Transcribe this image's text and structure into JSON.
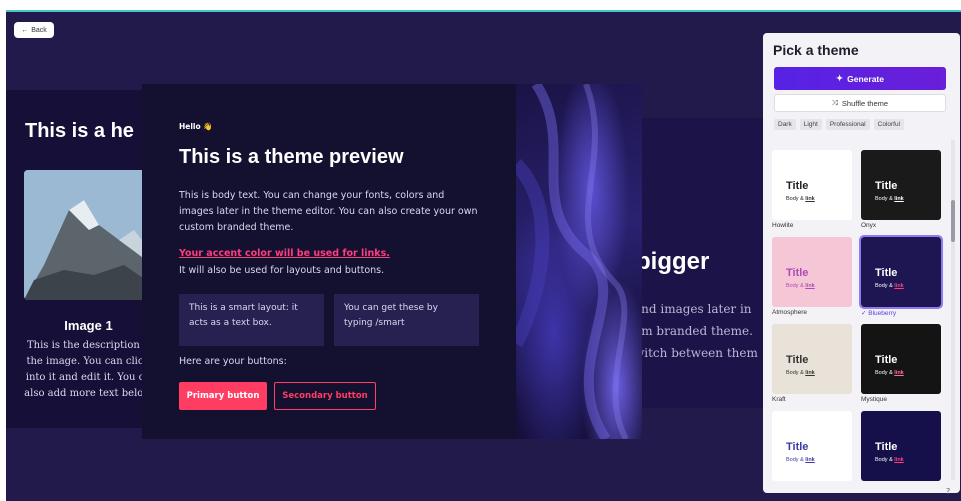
{
  "back_label": "Back",
  "left_card": {
    "heading": "This is a he",
    "image_title": "Image 1",
    "description": [
      "This is the description o",
      "the image. You can click",
      "into it and edit it. You ca",
      "also add more text below"
    ]
  },
  "right_card": {
    "heading": "bigger",
    "lines": [
      "and images later in",
      "om branded theme.",
      "witch between them"
    ]
  },
  "preview": {
    "hello": "Hello 👋",
    "title": "This is a theme preview",
    "body": "This is body text. You can change your fonts, colors and images later in the theme editor. You can also create your own custom branded theme.",
    "accent_link": "Your accent color will be used for links.",
    "accent_sub": "It will also be used for layouts and buttons.",
    "smart_box_1": "This is a smart layout: it acts as a text box.",
    "smart_box_2": "You can get these by typing /smart",
    "buttons_label": "Here are your buttons:",
    "primary_button": "Primary button",
    "secondary_button": "Secondary button"
  },
  "panel": {
    "title": "Pick a theme",
    "generate": "Generate",
    "shuffle": "Shuffle theme",
    "filters": [
      "Dark",
      "Light",
      "Professional",
      "Colorful"
    ],
    "themes": [
      {
        "name": "Howlite",
        "title": "Title",
        "body": "Body & ",
        "link": "link",
        "bg": "#ffffff",
        "fg": "#222222",
        "link_color": "#333333"
      },
      {
        "name": "Onyx",
        "title": "Title",
        "body": "Body & ",
        "link": "link",
        "bg": "#1a1a1a",
        "fg": "#ffffff",
        "link_color": "#ffffff"
      },
      {
        "name": "Atmosphere",
        "title": "Title",
        "body": "Body & ",
        "link": "link",
        "bg": "#f4c6d6",
        "fg": "#b14ab9",
        "link_color": "#b14ab9"
      },
      {
        "name": "Blueberry",
        "title": "Title",
        "body": "Body & ",
        "link": "link",
        "bg": "#1e1652",
        "fg": "#ffffff",
        "link_color": "#ff3d7f",
        "selected": true
      },
      {
        "name": "Kraft",
        "title": "Title",
        "body": "Body & ",
        "link": "link",
        "bg": "#e8e2d8",
        "fg": "#333333",
        "link_color": "#333333"
      },
      {
        "name": "Mystique",
        "title": "Title",
        "body": "Body & ",
        "link": "link",
        "bg": "#141414",
        "fg": "#ffffff",
        "link_color": "#ff6aa8"
      },
      {
        "name": "",
        "title": "Title",
        "body": "Body & ",
        "link": "link",
        "bg": "#ffffff",
        "fg": "#3d3aa8",
        "link_color": "#3d3aa8"
      },
      {
        "name": "",
        "title": "Title",
        "body": "Body & ",
        "link": "link",
        "bg": "#16104a",
        "fg": "#ffffff",
        "link_color": "#ff3d7f"
      }
    ]
  }
}
